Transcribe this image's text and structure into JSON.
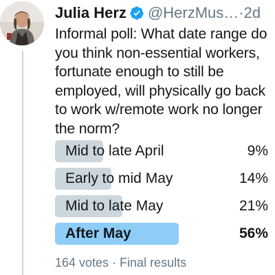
{
  "author": {
    "name": "Julia Herz",
    "handle": "@HerzMus…",
    "separator": " · ",
    "time": "2d"
  },
  "tweet": {
    "text": "Informal poll: What date range do you think non-essential workers, fortunate enough to still be employed, will physically go back to work w/remote work no longer the norm?"
  },
  "poll": {
    "options": [
      {
        "label": "Mid to late April",
        "percent": "9%",
        "value": 9,
        "winner": false
      },
      {
        "label": "Early to mid May",
        "percent": "14%",
        "value": 14,
        "winner": false
      },
      {
        "label": "Mid to late May",
        "percent": "21%",
        "value": 21,
        "winner": false
      },
      {
        "label": "After May",
        "percent": "56%",
        "value": 56,
        "winner": true
      }
    ],
    "footer": "164 votes · Final results"
  },
  "colors": {
    "bar": "#ccd6dd",
    "winner_bar": "#8ecdf8",
    "verified": "#1da1f2",
    "secondary_text": "#657786"
  },
  "icons": {
    "verified": "verified-badge-icon"
  }
}
